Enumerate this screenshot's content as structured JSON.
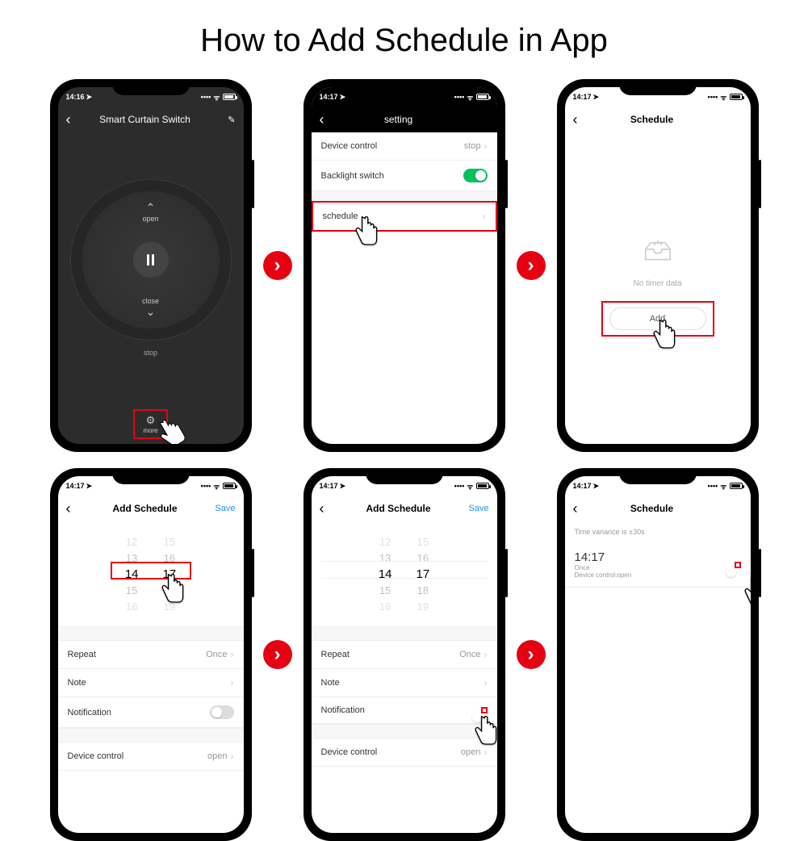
{
  "page_title": "How to Add Schedule in App",
  "status_time_a": "14:16",
  "status_time_b": "14:17",
  "loc_icon": "➤",
  "screens": {
    "s1": {
      "title": "Smart Curtain Switch",
      "open": "open",
      "close": "close",
      "stop": "stop",
      "more": "more"
    },
    "s2": {
      "title": "setting",
      "device_control": "Device control",
      "device_control_val": "stop",
      "backlight": "Backlight switch",
      "schedule": "schedule"
    },
    "s3": {
      "title": "Schedule",
      "empty": "No timer data",
      "add": "Add"
    },
    "s4": {
      "title": "Add Schedule",
      "save": "Save",
      "picker_above2": "12",
      "picker_above1_h": "13",
      "picker_above1_m": "16",
      "picker_sel_h": "14",
      "picker_sel_m": "17",
      "picker_below1_h": "15",
      "picker_below1_m": "18",
      "picker_below2_h": "16",
      "picker_below2_m": "19",
      "repeat": "Repeat",
      "repeat_val": "Once",
      "note": "Note",
      "notification": "Notification",
      "device_control": "Device control",
      "device_control_val": "open"
    },
    "s6": {
      "title": "Schedule",
      "variance": "Time variance is  ±30s",
      "time": "14:17",
      "detail": "Once\nDevice control:open"
    }
  }
}
